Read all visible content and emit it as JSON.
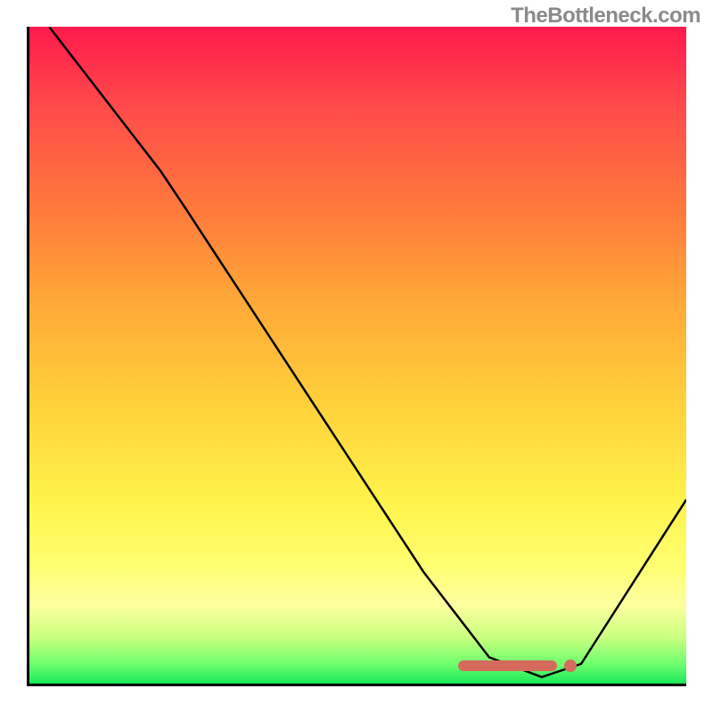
{
  "watermark": "TheBottleneck.com",
  "chart_data": {
    "type": "line",
    "title": "",
    "xlabel": "",
    "ylabel": "",
    "xlim": [
      0,
      100
    ],
    "ylim": [
      0,
      100
    ],
    "grid": false,
    "legend": false,
    "description": "Bottleneck-percentage style curve over vertical rainbow gradient (red top to green bottom). V-shaped curve reaching nearly zero around x≈78, with a horizontal highlighted optimal-range marker along the bottom near the minimum.",
    "curve": [
      {
        "x": 3,
        "y": 100
      },
      {
        "x": 20,
        "y": 78
      },
      {
        "x": 24,
        "y": 72
      },
      {
        "x": 60,
        "y": 17
      },
      {
        "x": 70,
        "y": 4
      },
      {
        "x": 78,
        "y": 1
      },
      {
        "x": 84,
        "y": 3
      },
      {
        "x": 100,
        "y": 28
      }
    ],
    "marker_range": {
      "start_x": 65,
      "end_x": 80,
      "dot_x": 82
    },
    "gradient_stops": [
      {
        "pos": 0,
        "color": "#ff1a4d"
      },
      {
        "pos": 12,
        "color": "#ff4a4a"
      },
      {
        "pos": 28,
        "color": "#ff7a3c"
      },
      {
        "pos": 42,
        "color": "#ffa938"
      },
      {
        "pos": 58,
        "color": "#ffd23a"
      },
      {
        "pos": 72,
        "color": "#fff24a"
      },
      {
        "pos": 82,
        "color": "#ffff70"
      },
      {
        "pos": 88,
        "color": "#fdffa0"
      },
      {
        "pos": 93,
        "color": "#c9ff7e"
      },
      {
        "pos": 97,
        "color": "#6fff6f"
      },
      {
        "pos": 100,
        "color": "#19e85a"
      }
    ]
  }
}
